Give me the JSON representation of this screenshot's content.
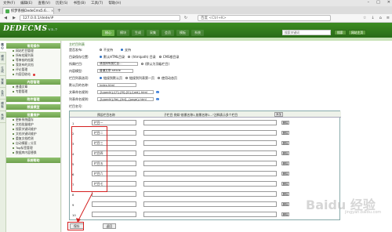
{
  "browser": {
    "menu": [
      "文件(F)",
      "编辑(E)",
      "查看(V)",
      "历史(S)",
      "书签(B)",
      "工具(T)",
      "帮助(H)"
    ],
    "tab_title": "织梦系统DedeCms5.6...",
    "url": "127.0.0.1/dede/#",
    "search_placeholder": "百度 <Ctrl+K>"
  },
  "header": {
    "logo": "DEDECMS",
    "version": "V5.7",
    "nav": [
      "核心",
      "模块",
      "生成",
      "采集",
      "会员",
      "模板",
      "系统"
    ],
    "search_placeholder": "搜索关键词",
    "btn1": "搜索",
    "btn2": "网站主页"
  },
  "sidenav": [
    "核心",
    "模块",
    "生成",
    "采集",
    "会员",
    "模板",
    "系统"
  ],
  "sidebar": {
    "sections": [
      {
        "title": "常用操作",
        "items": [
          "网站栏目管理",
          "所有档案列表",
          "等审核的档案",
          "我发布的文档",
          "评论管理",
          "内容回收站"
        ]
      },
      {
        "title": "内容管理",
        "items": [
          "普通文章",
          "专题管理"
        ]
      },
      {
        "title": "附件管理",
        "items": []
      },
      {
        "title": "频道模型",
        "items": []
      },
      {
        "title": "批量维护",
        "items": [
          "更新系统缓存",
          "文档批量维护",
          "搜索关键词维护",
          "文档关键词维护",
          "重复文档检测",
          "自动摘要 | 分页",
          "Tag标签管理",
          "数据库内容替换"
        ]
      },
      {
        "title": "系统帮助",
        "items": []
      }
    ]
  },
  "form": {
    "top_label": "主栏目列表",
    "r1_label": "是否发布:",
    "r1_opts": [
      "不支持",
      "支持"
    ],
    "r2_label": "目录保存位置:",
    "r2_opts": [
      "默认HTML目录",
      "(htmlpath) 目录"
    ],
    "r2_extra": "CMS根目录",
    "r3_label": "所属栏目:",
    "r3_value": "请选择所属栏目...",
    "r3_note": "(默认为顶级栏目)",
    "r4_label": "内容模型:",
    "r4_value": "普通文章 article",
    "r5_label": "栏目列表选项:",
    "r5_opts": [
      "链接到默认页",
      "链接到列表第一页",
      "使用动态页"
    ],
    "r6_label": "默认页的名称:",
    "r6_value": "index.html",
    "r7_label": "文章命名规则:",
    "r7_value": "{typedir}/{Y}{M}{D}/{aid}.html",
    "r8_label": "列表命名规则:",
    "r8_value": "{typedir}/list_{tid}_{page}.html",
    "col_title": "栏目名号:"
  },
  "table": {
    "h_name": "预设栏目名称",
    "h_path": "子栏目 例如\"前景名称1,前景名称1...\"注释表示多个栏目",
    "add_label": "添加",
    "del_label": "删除",
    "rows": [
      {
        "num": "1",
        "name": "栏目一"
      },
      {
        "num": "2",
        "name": "栏目二"
      },
      {
        "num": "3",
        "name": "栏目三"
      },
      {
        "num": "4",
        "name": "栏目四"
      },
      {
        "num": "5",
        "name": "栏目五"
      },
      {
        "num": "6",
        "name": "栏目六"
      },
      {
        "num": "7",
        "name": "栏目七"
      },
      {
        "num": "8",
        "name": ""
      },
      {
        "num": "9",
        "name": ""
      },
      {
        "num": "10",
        "name": ""
      }
    ]
  },
  "buttons": {
    "save": "保存",
    "back": "返回"
  },
  "watermark": "Baidu 经验",
  "watermark_sub": "jingyan.baidu.com"
}
